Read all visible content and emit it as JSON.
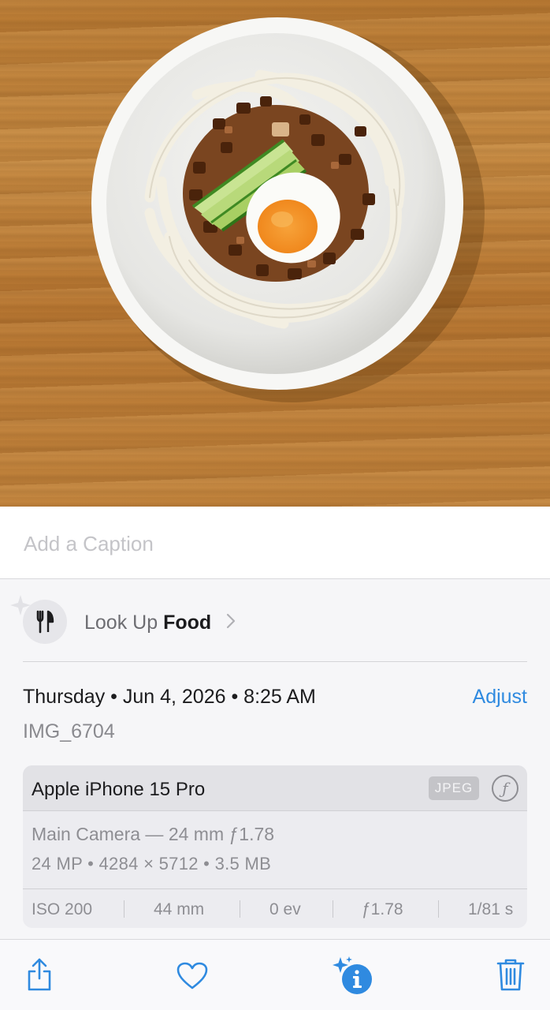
{
  "photo": {
    "subject": ""
  },
  "caption": {
    "placeholder": "Add a Caption"
  },
  "lookup": {
    "prefix": "Look Up",
    "subject": "Food"
  },
  "info": {
    "date_text": "Thursday • Jun 4, 2026 • 8:25 AM",
    "adjust_label": "Adjust",
    "filename": "IMG_6704"
  },
  "camera": {
    "device": "Apple iPhone 15 Pro",
    "format_badge": "JPEG",
    "lens": "Main Camera — 24 mm ƒ1.78",
    "specs": "24 MP  •  4284 × 5712  •  3.5 MB",
    "exif": {
      "iso": "ISO 200",
      "focal": "44 mm",
      "ev": "0 ev",
      "aperture": "ƒ1.78",
      "shutter": "1/81 s"
    }
  },
  "toolbar": {
    "icons": [
      "share-icon",
      "heart-icon",
      "info-sparkle-icon",
      "trash-icon"
    ]
  },
  "colors": {
    "accent": "#2f8ae0",
    "sheet_bg": "#f6f6f8"
  }
}
